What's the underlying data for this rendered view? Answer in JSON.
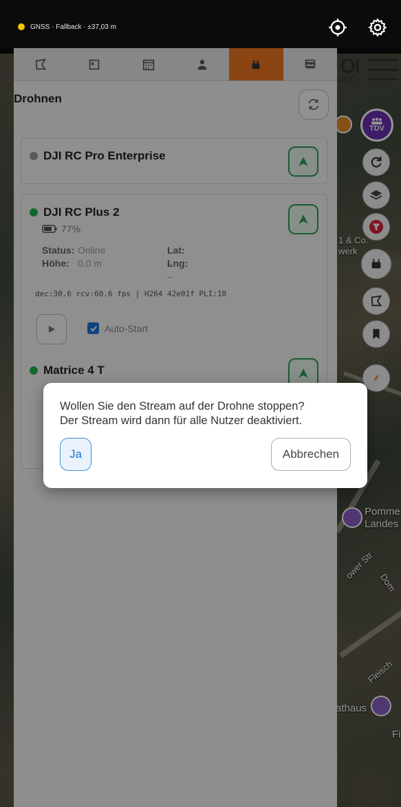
{
  "status": {
    "gnss_text": "GNSS · Fallback · ±37,03 m",
    "gnss_color": "#f5c400"
  },
  "map": {
    "logo_text": "OI",
    "logo_sub": "DUD",
    "tdv_label": "TDV",
    "labels": [
      "1 & Co.",
      "werk",
      "Pomme",
      "Landes",
      "ower Str",
      "Dom",
      "Fleisch",
      "athaus",
      "Fi"
    ]
  },
  "panel": {
    "tabs": [
      {
        "icon": "polygon-icon"
      },
      {
        "icon": "map-card-icon"
      },
      {
        "icon": "calendar-icon"
      },
      {
        "icon": "team-icon"
      },
      {
        "icon": "drone-controller-icon",
        "active": true
      },
      {
        "icon": "layers-list-icon"
      }
    ],
    "title": "Drohnen",
    "accent": "#f07522"
  },
  "drones": [
    {
      "name": "DJI RC Pro Enterprise",
      "status_color": "#9a9a9a"
    },
    {
      "name": "DJI RC Plus 2",
      "status_color": "#24b24a",
      "battery": "77%",
      "status_label": "Status:",
      "status_value": "Online",
      "height_label": "Höhe:",
      "height_value": "0.0 m",
      "lat_label": "Lat:",
      "lat_value": "–",
      "lng_label": "Lng:",
      "lng_value": "–",
      "stream_stats": "dec:30.6 rcv:60.6 fps | H264 42e01f PLI:18",
      "autostart_label": "Auto-Start"
    },
    {
      "name": "Matrice 4 T",
      "status_color": "#24b24a"
    }
  ],
  "dialog": {
    "line1": "Wollen Sie den Stream auf der Drohne stoppen?",
    "line2": "Der Stream wird dann für alle Nutzer deaktiviert.",
    "yes_label": "Ja",
    "cancel_label": "Abbrechen"
  }
}
